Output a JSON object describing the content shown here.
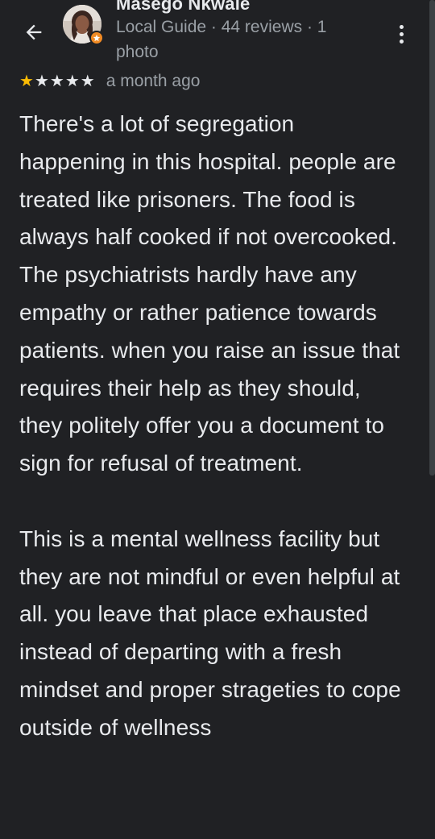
{
  "reviewer": {
    "name": "Masego Nkwale",
    "meta": "Local Guide · 44 reviews · 1 photo"
  },
  "rating": {
    "stars": 1,
    "max": 5,
    "date": "a month ago"
  },
  "review": {
    "paragraph_1": "There's a lot of segregation happening in this hospital. people are treated like prisoners. The food is always half cooked if not overcooked. The psychiatrists hardly have any empathy or rather patience towards patients. when you raise an issue that requires their help as they should, they politely offer you a document to sign for refusal of treatment.",
    "paragraph_2": "This is a mental wellness facility but they are not mindful or even helpful at all. you leave that place exhausted instead of departing with a fresh mindset and proper strageties to cope outside of wellness"
  },
  "icons": {
    "back": "arrow-back-icon",
    "more": "more-vert-icon",
    "badge": "local-guide-badge-icon",
    "star": "star-icon"
  },
  "colors": {
    "background": "#202124",
    "text_primary": "#e8eaed",
    "text_secondary": "#9aa0a6",
    "star_filled": "#fbbc04",
    "guide_badge": "#f28b24"
  }
}
